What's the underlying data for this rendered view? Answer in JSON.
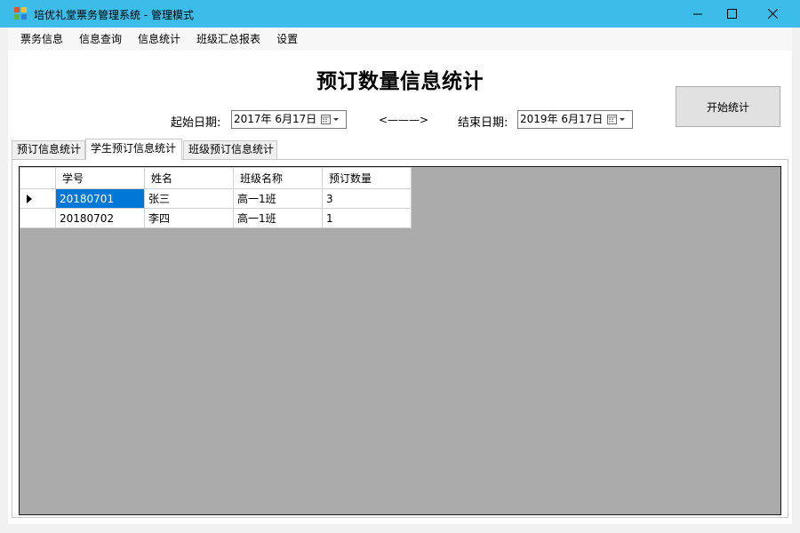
{
  "window": {
    "title": "培优礼堂票务管理系统 - 管理模式"
  },
  "menu": [
    "票务信息",
    "信息查询",
    "信息统计",
    "班级汇总报表",
    "设置"
  ],
  "headline": "预订数量信息统计",
  "filters": {
    "start_label": "起始日期:",
    "start_date": "2017年  6月17日",
    "arrow": "<———>",
    "end_label": "结束日期:",
    "end_date": "2019年  6月17日"
  },
  "start_button": "开始统计",
  "tabs": [
    {
      "label": "预订信息统计",
      "active": false
    },
    {
      "label": "学生预订信息统计",
      "active": true
    },
    {
      "label": "班级预订信息统计",
      "active": false
    }
  ],
  "grid": {
    "columns": [
      "学号",
      "姓名",
      "班级名称",
      "预订数量"
    ],
    "rows": [
      [
        "20180701",
        "张三",
        "高一1班",
        "3"
      ],
      [
        "20180702",
        "李四",
        "高一1班",
        "1"
      ]
    ],
    "selected_row": 0
  },
  "colors": {
    "titlebar": "#3cbde9",
    "selection": "#0078d7",
    "grid_background": "#ababab"
  }
}
